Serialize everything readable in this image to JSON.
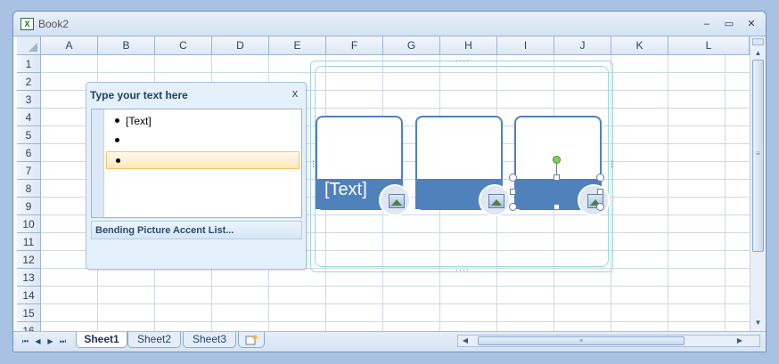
{
  "window": {
    "title": "Book2",
    "app_icon": "excel-icon",
    "minimize": "–",
    "maximize": "▭",
    "close": "✕"
  },
  "columns": [
    "A",
    "B",
    "C",
    "D",
    "E",
    "F",
    "G",
    "H",
    "I",
    "J",
    "K",
    "L"
  ],
  "rows": [
    "1",
    "2",
    "3",
    "4",
    "5",
    "6",
    "7",
    "8",
    "9",
    "10",
    "11",
    "12",
    "13",
    "14",
    "15",
    "16"
  ],
  "text_pane": {
    "title": "Type your text here",
    "close": "x",
    "bullets": [
      "[Text]",
      "",
      ""
    ],
    "selected_bullet": 2,
    "layout_name": "Bending Picture Accent List..."
  },
  "smartart": {
    "cards": [
      {
        "text": "[Text]",
        "selected": false
      },
      {
        "text": "",
        "selected": false
      },
      {
        "text": "",
        "selected": true
      }
    ],
    "accent_color": "#4f81bd",
    "frame_color": "#9dd5dd"
  },
  "sheet_tabs": [
    {
      "label": "Sheet1",
      "active": true
    },
    {
      "label": "Sheet2",
      "active": false
    },
    {
      "label": "Sheet3",
      "active": false
    }
  ],
  "nav_buttons": [
    "⏮",
    "◀",
    "▶",
    "⏭"
  ],
  "scroll": {
    "up": "▲",
    "down": "▼",
    "left": "◀",
    "right": "▶",
    "grip": "≡"
  }
}
